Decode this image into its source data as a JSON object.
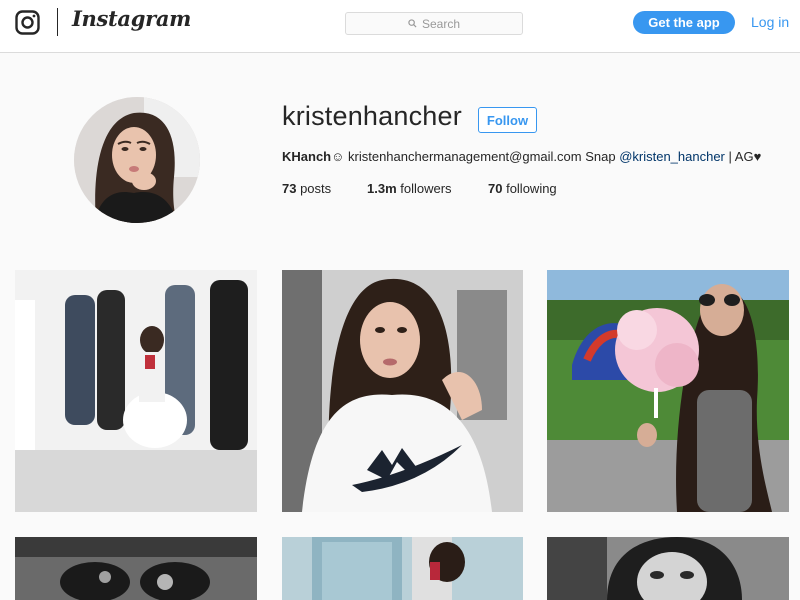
{
  "header": {
    "logo_name": "instagram-camera-icon",
    "wordmark": "Instagram",
    "search_placeholder": "Search",
    "get_app_label": "Get the app",
    "login_label": "Log in"
  },
  "profile": {
    "username": "kristenhancher",
    "follow_label": "Follow",
    "bio": {
      "name": "KHanch",
      "emoji": "☺",
      "text_after_emoji": " kristenhanchermanagement@gmail.com Snap ",
      "mention": "@kristen_hancher",
      "tail": " | AG",
      "heart": "♥"
    },
    "stats": {
      "posts_count": "73",
      "posts_label": " posts",
      "followers_count": "1.3m",
      "followers_label": " followers",
      "following_count": "70",
      "following_label": " following"
    }
  },
  "posts": [
    {
      "name": "post-group-mirror-selfie"
    },
    {
      "name": "post-nike-shirt-selfie"
    },
    {
      "name": "post-cotton-candy"
    },
    {
      "name": "post-sunglasses-bw"
    },
    {
      "name": "post-bathroom-mirror"
    },
    {
      "name": "post-bw-portrait"
    }
  ],
  "colors": {
    "accent": "#3897f0",
    "text": "#262626",
    "border": "#dbdbdb",
    "background": "#fafafa"
  }
}
